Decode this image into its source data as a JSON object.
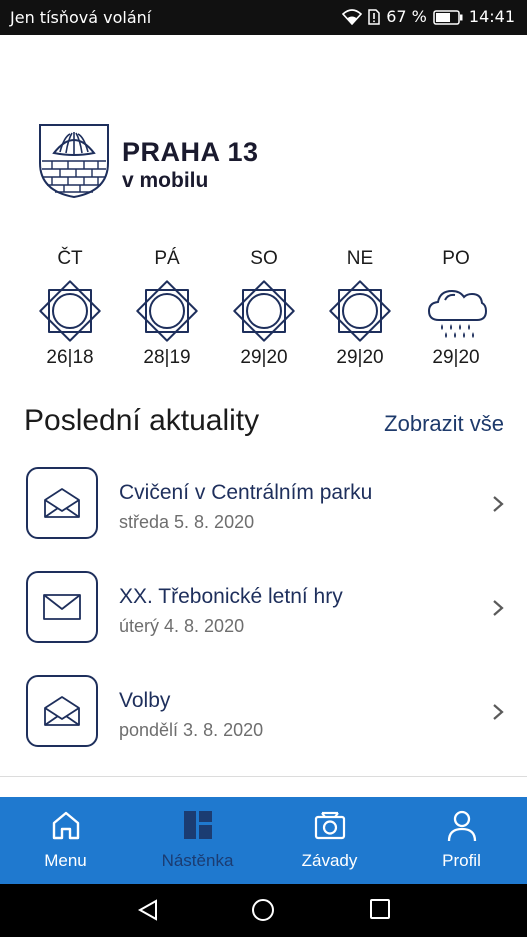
{
  "status": {
    "carrier": "Jen tísňová volání",
    "battery": "67 %",
    "time": "14:41"
  },
  "brand": {
    "title": "PRAHA 13",
    "subtitle": "v mobilu"
  },
  "weather": [
    {
      "day": "ČT",
      "temp": "26|18",
      "icon": "sun-icon"
    },
    {
      "day": "PÁ",
      "temp": "28|19",
      "icon": "sun-icon"
    },
    {
      "day": "SO",
      "temp": "29|20",
      "icon": "sun-icon"
    },
    {
      "day": "NE",
      "temp": "29|20",
      "icon": "sun-icon"
    },
    {
      "day": "PO",
      "temp": "29|20",
      "icon": "rain-cloud-icon"
    }
  ],
  "news": {
    "title": "Poslední aktuality",
    "show_all": "Zobrazit vše",
    "items": [
      {
        "title": "Cvičení v Centrálním parku",
        "date": "středa 5. 8. 2020",
        "icon": "envelope-open-icon"
      },
      {
        "title": "XX. Třebonické letní hry",
        "date": "úterý 4. 8. 2020",
        "icon": "envelope-closed-icon"
      },
      {
        "title": "Volby",
        "date": "pondělí 3. 8. 2020",
        "icon": "envelope-open-icon"
      }
    ]
  },
  "nav": [
    {
      "label": "Menu",
      "icon": "home-icon"
    },
    {
      "label": "Nástěnka",
      "icon": "dashboard-icon",
      "active": true
    },
    {
      "label": "Závady",
      "icon": "camera-icon"
    },
    {
      "label": "Profil",
      "icon": "person-icon"
    }
  ],
  "colors": {
    "accent": "#1f79cf",
    "navy": "#1e2f5c",
    "active_tab": "#1b3c72"
  }
}
